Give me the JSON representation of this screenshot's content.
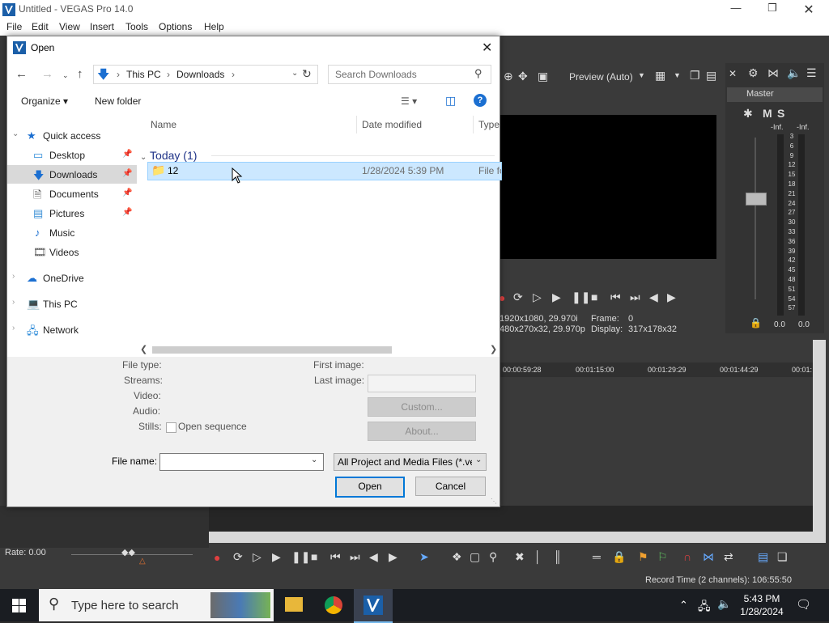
{
  "app": {
    "title": "Untitled - VEGAS Pro 14.0",
    "menu": [
      "File",
      "Edit",
      "View",
      "Insert",
      "Tools",
      "Options",
      "Help"
    ],
    "window_buttons": [
      "minimize",
      "restore",
      "close"
    ]
  },
  "preview": {
    "mode_label": "Preview (Auto)",
    "info_left_1": "1920x1080, 29.970i",
    "info_left_2": "480x270x32, 29.970p",
    "frame_label": "Frame:",
    "frame_value": "0",
    "display_label": "Display:",
    "display_value": "317x178x32"
  },
  "master": {
    "label": "Master",
    "m": "M",
    "s": "S",
    "inf_left": "-Inf.",
    "inf_right": "-Inf.",
    "scale": [
      "3",
      "6",
      "9",
      "12",
      "15",
      "18",
      "21",
      "24",
      "27",
      "30",
      "33",
      "36",
      "39",
      "42",
      "45",
      "48",
      "51",
      "54",
      "57"
    ],
    "bottom_left": "0.0",
    "bottom_right": "0.0"
  },
  "timeline": {
    "ruler": [
      "00:00:59:28",
      "00:01:15:00",
      "00:01:29:29",
      "00:01:44:29",
      "00:01:"
    ],
    "rate": "Rate: 0.00",
    "record_time": "Record Time (2 channels): 106:55:50"
  },
  "dialog": {
    "title": "Open",
    "address": {
      "this_pc": "This PC",
      "downloads": "Downloads"
    },
    "search_placeholder": "Search Downloads",
    "organize": "Organize",
    "new_folder": "New folder",
    "nav": {
      "quick_access": "Quick access",
      "desktop": "Desktop",
      "downloads": "Downloads",
      "documents": "Documents",
      "pictures": "Pictures",
      "music": "Music",
      "videos": "Videos",
      "onedrive": "OneDrive",
      "this_pc": "This PC",
      "network": "Network"
    },
    "columns": {
      "name": "Name",
      "date": "Date modified",
      "type": "Type"
    },
    "group": "Today (1)",
    "file": {
      "name": "12",
      "date": "1/28/2024 5:39 PM",
      "type": "File fo"
    },
    "meta": {
      "file_type": "File type:",
      "streams": "Streams:",
      "video": "Video:",
      "audio": "Audio:",
      "stills": "Stills:",
      "open_sequence": "Open sequence",
      "first_image": "First image:",
      "last_image": "Last image:",
      "custom": "Custom...",
      "about": "About..."
    },
    "file_name_label": "File name:",
    "file_name_value": "",
    "filter": "All Project and Media Files (*.ve",
    "open": "Open",
    "cancel": "Cancel"
  },
  "taskbar": {
    "search_placeholder": "Type here to search",
    "time": "5:43 PM",
    "date": "1/28/2024"
  }
}
